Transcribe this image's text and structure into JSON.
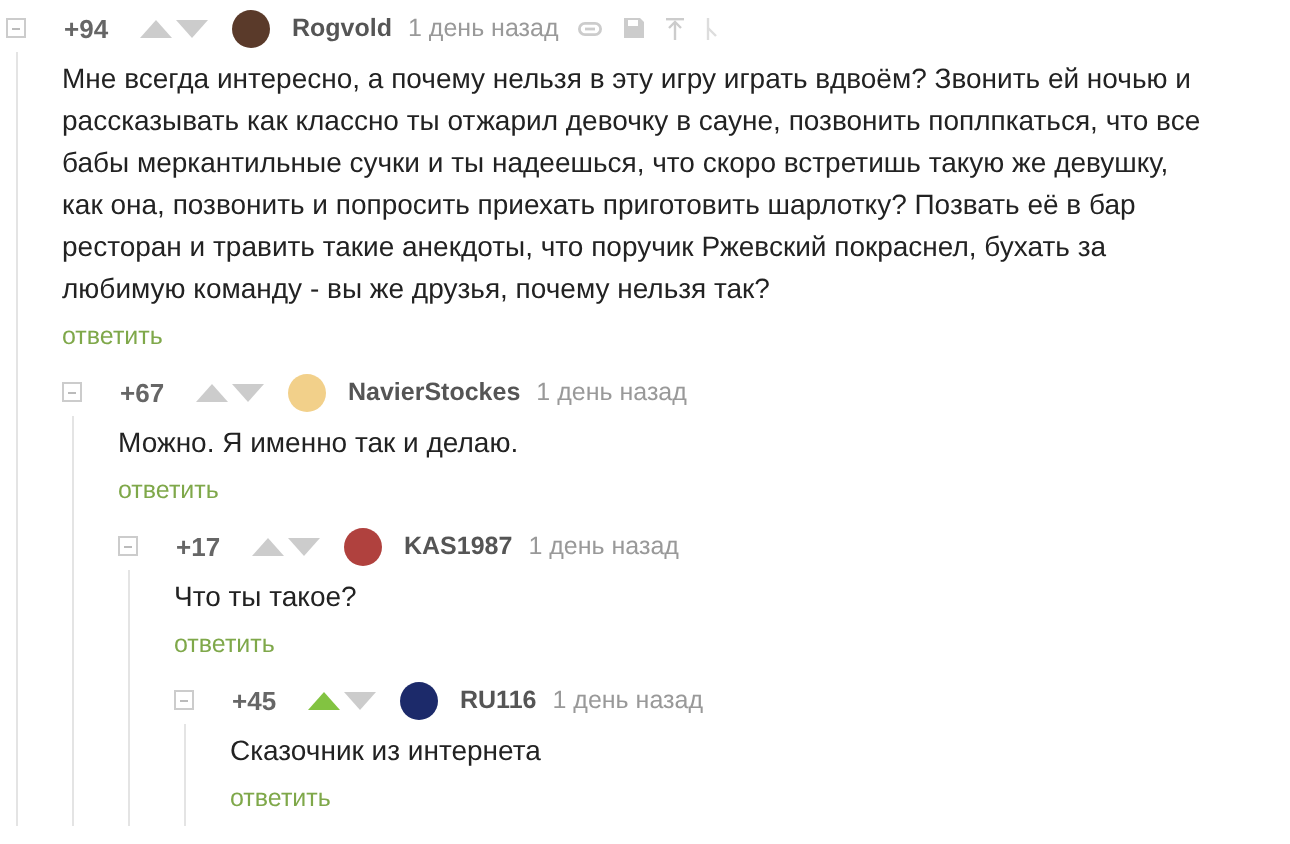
{
  "comments": [
    {
      "rating": "+94",
      "upvoted": false,
      "author": "Rogvold",
      "color": "#5a3a2a",
      "time": "1 день назад",
      "show_actions": true,
      "text": "Мне всегда интересно, а почему нельзя в эту игру играть вдвоём? Звонить ей ночью и рассказывать как классно ты отжарил девочку в сауне, позвонить поплпкаться, что все бабы меркантильные сучки и ты надеешься, что скоро встретишь такую же девушку, как она, позвонить и попросить приехать приготовить шарлотку? Позвать её в бар ресторан и травить такие анекдоты, что поручик Ржевский покраснел, бухать за любимую команду - вы же друзья, почему нельзя так?",
      "reply": "ответить",
      "children": [
        {
          "rating": "+67",
          "upvoted": false,
          "author": "NavierStockes",
          "color": "#f2d08a",
          "time": "1 день назад",
          "show_actions": false,
          "text": "Можно. Я именно так и делаю.",
          "reply": "ответить",
          "children": [
            {
              "rating": "+17",
              "upvoted": false,
              "author": "KAS1987",
              "color": "#b0413e",
              "time": "1 день назад",
              "show_actions": false,
              "text": "Что ты такое?",
              "reply": "ответить",
              "children": [
                {
                  "rating": "+45",
                  "upvoted": true,
                  "author": "RU116",
                  "color": "#1c2a6a",
                  "time": "1 день назад",
                  "show_actions": false,
                  "text": "Сказочник из интернета",
                  "reply": "ответить"
                }
              ]
            }
          ]
        }
      ]
    }
  ]
}
